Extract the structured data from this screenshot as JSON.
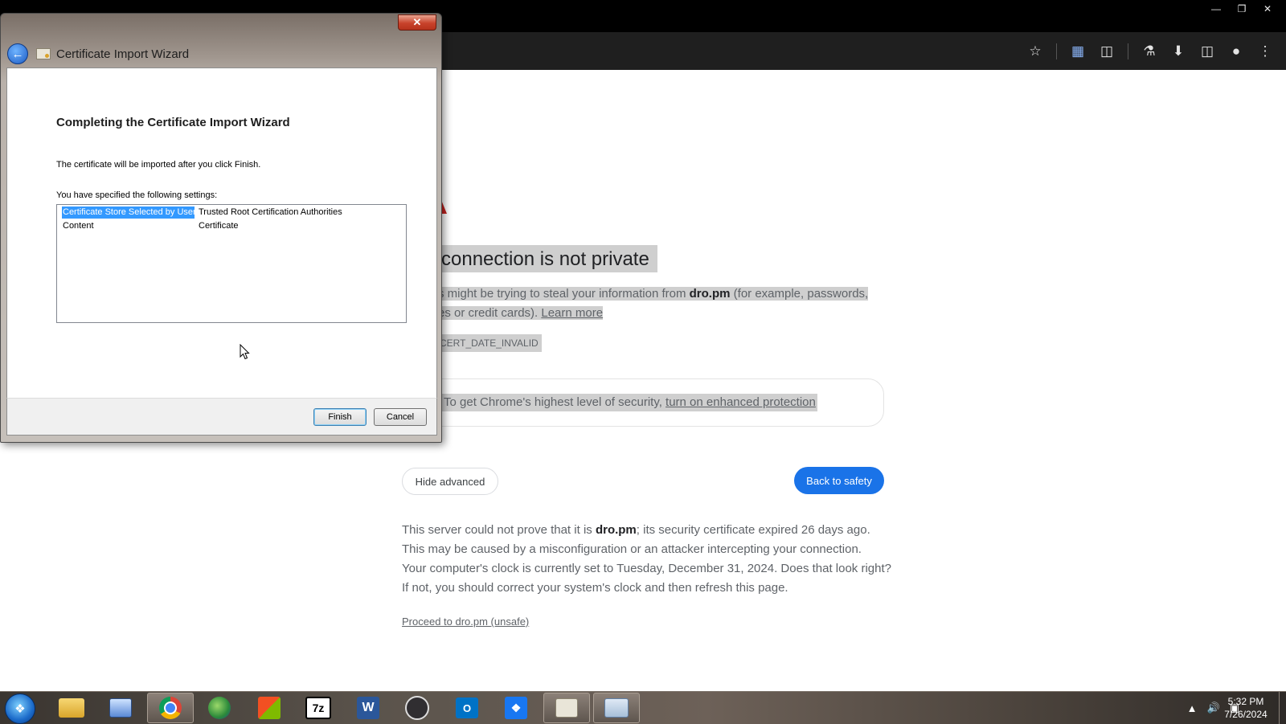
{
  "browser": {
    "toolbar_icons": [
      "star-icon",
      "media-icon",
      "extensions-icon",
      "labs-icon",
      "download-icon",
      "side-panel-icon",
      "profile-icon",
      "menu-icon"
    ]
  },
  "interstitial": {
    "heading": "connection is not private",
    "explain_prefix": "s might be trying to steal your information from ",
    "domain": "dro.pm",
    "explain_suffix": " (for example, passwords,",
    "explain_line2": "es or credit cards). ",
    "learn_more": "Learn more",
    "error_code": "CERT_DATE_INVALID",
    "enhanced_prefix": "To get Chrome's highest level of security, ",
    "enhanced_link": "turn on enhanced protection",
    "hide_advanced": "Hide advanced",
    "back_to_safety": "Back to safety",
    "details_1a": "This server could not prove that it is ",
    "details_1b": "; its security certificate expired 26 days ago.",
    "details_2": "This may be caused by a misconfiguration or an attacker intercepting your connection.",
    "details_3": "Your computer's clock is currently set to Tuesday, December 31, 2024. Does that look right?",
    "details_4": "If not, you should correct your system's clock and then refresh this page.",
    "proceed": "Proceed to dro.pm (unsafe)"
  },
  "dialog": {
    "title": "Certificate Import Wizard",
    "heading": "Completing the Certificate Import Wizard",
    "line1": "The certificate will be imported after you click Finish.",
    "line2": "You have specified the following settings:",
    "settings": [
      {
        "key": "Certificate Store Selected by User",
        "value": "Trusted Root Certification Authorities"
      },
      {
        "key": "Content",
        "value": "Certificate"
      }
    ],
    "finish": "Finish",
    "cancel": "Cancel"
  },
  "taskbar": {
    "apps": [
      "start-orb",
      "file-explorer",
      "remote-desktop",
      "chrome",
      "app-4",
      "app-5",
      "7-zip",
      "word",
      "obs",
      "outlook",
      "app-11",
      "cert-manager",
      "import-wizard"
    ],
    "label_7zip": "7z",
    "label_word": "W",
    "time": "5:32 PM",
    "date": "7/26/2024"
  }
}
